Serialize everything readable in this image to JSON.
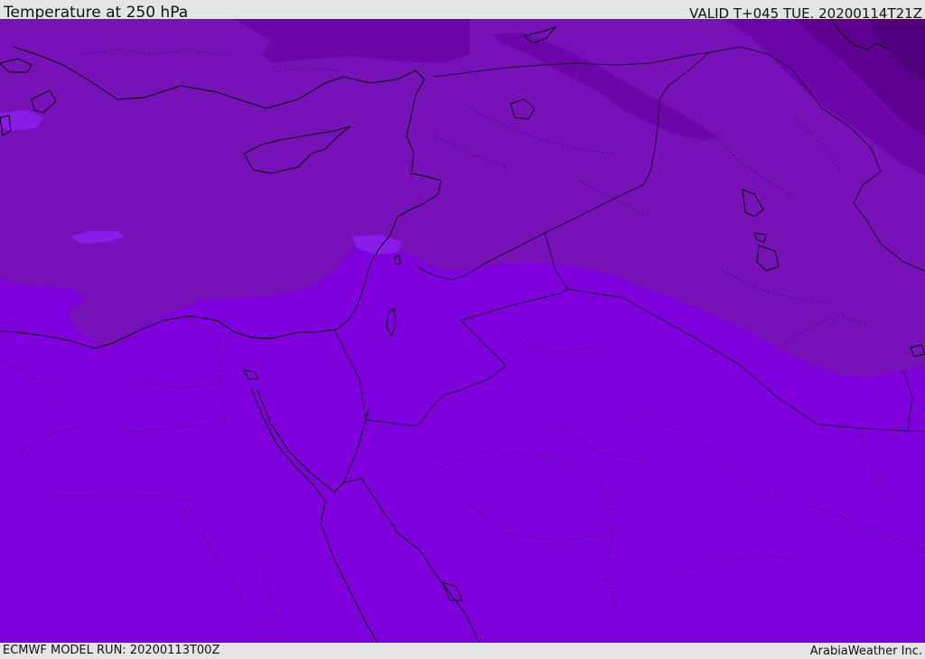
{
  "header": {
    "title": "Temperature at 250 hPa",
    "valid": "VALID T+045 TUE. 20200114T21Z"
  },
  "footer": {
    "model_run": "ECMWF MODEL RUN: 20200113T00Z",
    "credit": "ArabiaWeather Inc."
  },
  "map": {
    "field": "temperature-250hPa",
    "colors": {
      "warm_band": "#7f00dc",
      "mid_band": "#7711b8",
      "cool_band": "#6d06a8",
      "cold_band": "#5e008f",
      "coldest_band": "#52007e",
      "pale_band": "#8a1be8",
      "coastline": "#000000",
      "border": "#1a0a33"
    }
  }
}
